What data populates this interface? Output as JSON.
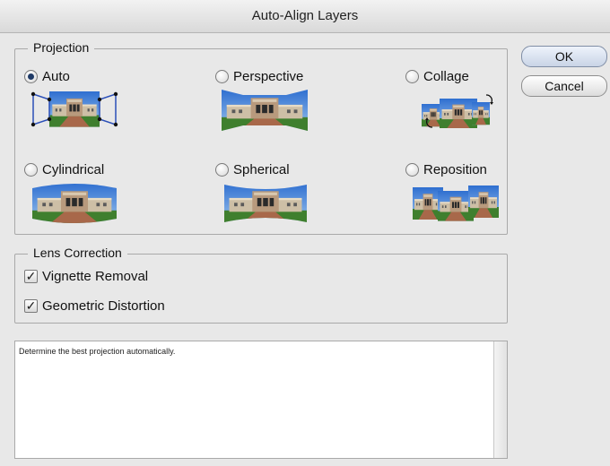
{
  "window": {
    "title": "Auto-Align Layers"
  },
  "buttons": {
    "ok": "OK",
    "cancel": "Cancel"
  },
  "projection": {
    "title": "Projection",
    "selected": "auto",
    "options": [
      {
        "id": "auto",
        "label": "Auto"
      },
      {
        "id": "perspective",
        "label": "Perspective"
      },
      {
        "id": "collage",
        "label": "Collage"
      },
      {
        "id": "cylindrical",
        "label": "Cylindrical"
      },
      {
        "id": "spherical",
        "label": "Spherical"
      },
      {
        "id": "reposition",
        "label": "Reposition"
      }
    ]
  },
  "lens_correction": {
    "title": "Lens Correction",
    "vignette_removal": {
      "label": "Vignette Removal",
      "checked": true
    },
    "geometric_distortion": {
      "label": "Geometric Distortion",
      "checked": true
    }
  },
  "description": {
    "text": "Determine the best projection automatically."
  }
}
